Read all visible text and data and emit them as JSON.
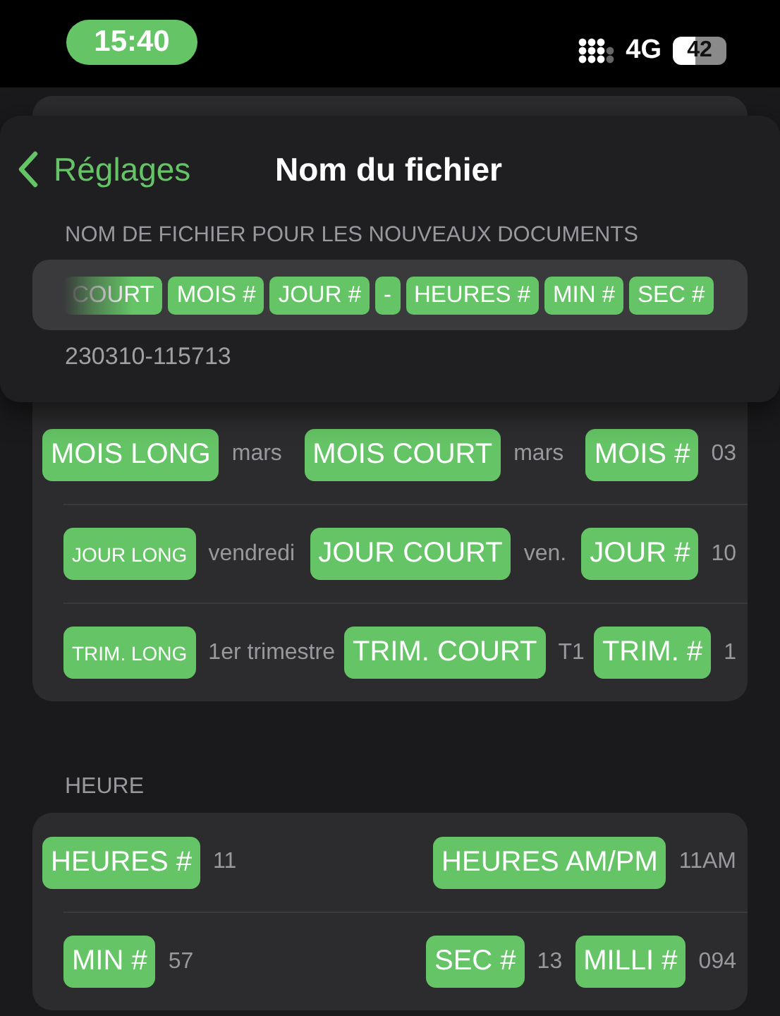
{
  "status_bar": {
    "time": "15:40",
    "network": "4G",
    "battery": "42"
  },
  "nav": {
    "back": "Réglages",
    "title": "Nom du fichier"
  },
  "filename": {
    "label": "NOM DE FICHIER POUR LES NOUVEAUX DOCUMENTS",
    "preview": "230310-115713",
    "tokens": [
      {
        "text": "COURT",
        "faded": true
      },
      {
        "text": "MOIS #",
        "faded": false
      },
      {
        "text": "JOUR #",
        "faded": false
      },
      {
        "text": "-",
        "faded": false
      },
      {
        "text": "HEURES #",
        "faded": false
      },
      {
        "text": "MIN #",
        "faded": false
      },
      {
        "text": "SEC #",
        "faded": false
      }
    ]
  },
  "date_rows": [
    {
      "groups": [
        [
          {
            "kind": "token",
            "text": "MOIS LONG"
          },
          {
            "kind": "value",
            "text": "mars"
          }
        ],
        [
          {
            "kind": "token",
            "text": "MOIS COURT"
          },
          {
            "kind": "value",
            "text": "mars"
          }
        ],
        [
          {
            "kind": "token",
            "text": "MOIS #"
          },
          {
            "kind": "value",
            "text": "03"
          }
        ]
      ]
    },
    {
      "groups": [
        [
          {
            "kind": "small-token",
            "text": "JOUR LONG"
          },
          {
            "kind": "value",
            "text": "vendredi"
          }
        ],
        [
          {
            "kind": "token",
            "text": "JOUR COURT"
          },
          {
            "kind": "value",
            "text": "ven."
          }
        ],
        [
          {
            "kind": "token",
            "text": "JOUR #"
          },
          {
            "kind": "value",
            "text": "10"
          }
        ]
      ]
    },
    {
      "groups": [
        [
          {
            "kind": "small-token",
            "text": "TRIM. LONG"
          },
          {
            "kind": "value",
            "text": "1er trimestre"
          }
        ],
        [
          {
            "kind": "token",
            "text": "TRIM. COURT"
          },
          {
            "kind": "value",
            "text": "T1"
          }
        ],
        [
          {
            "kind": "token",
            "text": "TRIM. #"
          },
          {
            "kind": "value",
            "text": "1"
          }
        ]
      ]
    }
  ],
  "time_section": {
    "label": "HEURE",
    "rows": [
      {
        "groups": [
          [
            {
              "kind": "token",
              "text": "HEURES #"
            },
            {
              "kind": "value",
              "text": "11"
            }
          ],
          [
            {
              "kind": "token",
              "text": "HEURES AM/PM"
            },
            {
              "kind": "value",
              "text": "11AM"
            }
          ]
        ]
      },
      {
        "groups": [
          [
            {
              "kind": "token",
              "text": "MIN #"
            },
            {
              "kind": "value",
              "text": "57"
            }
          ],
          [
            {
              "kind": "token",
              "text": "SEC #"
            },
            {
              "kind": "value",
              "text": "13"
            },
            {
              "kind": "token",
              "text": "MILLI #"
            },
            {
              "kind": "value",
              "text": "094"
            }
          ]
        ]
      }
    ]
  }
}
